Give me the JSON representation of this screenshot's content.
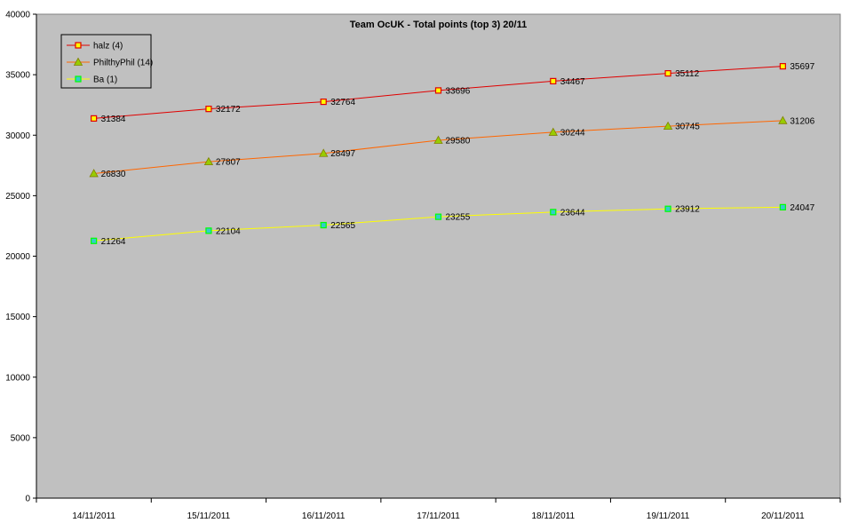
{
  "chart_data": {
    "type": "line",
    "title": "Team OcUK - Total points (top 3) 20/11",
    "categories": [
      "14/11/2011",
      "15/11/2011",
      "16/11/2011",
      "17/11/2011",
      "18/11/2011",
      "19/11/2011",
      "20/11/2011"
    ],
    "ylim": [
      0,
      40000
    ],
    "yticks": [
      0,
      5000,
      10000,
      15000,
      20000,
      25000,
      30000,
      35000,
      40000
    ],
    "grid": false,
    "legend_position": "top-left",
    "plot_background": "#c0c0c0",
    "series": [
      {
        "name": "halz (4)",
        "values": [
          31384,
          32172,
          32764,
          33696,
          34467,
          35112,
          35697
        ],
        "line_color": "#e00000",
        "marker": "square",
        "marker_fill": "#ffff00",
        "marker_edge": "#e00000"
      },
      {
        "name": "PhilthyPhil (14)",
        "values": [
          26830,
          27807,
          28497,
          29580,
          30244,
          30745,
          31206
        ],
        "line_color": "#ff6600",
        "marker": "triangle",
        "marker_fill": "#99cc00",
        "marker_edge": "#808000"
      },
      {
        "name": "Ba (1)",
        "values": [
          21264,
          22104,
          22565,
          23255,
          23644,
          23912,
          24047
        ],
        "line_color": "#ffff00",
        "marker": "square",
        "marker_fill": "#33cccc",
        "marker_edge": "#00ff00"
      }
    ]
  }
}
